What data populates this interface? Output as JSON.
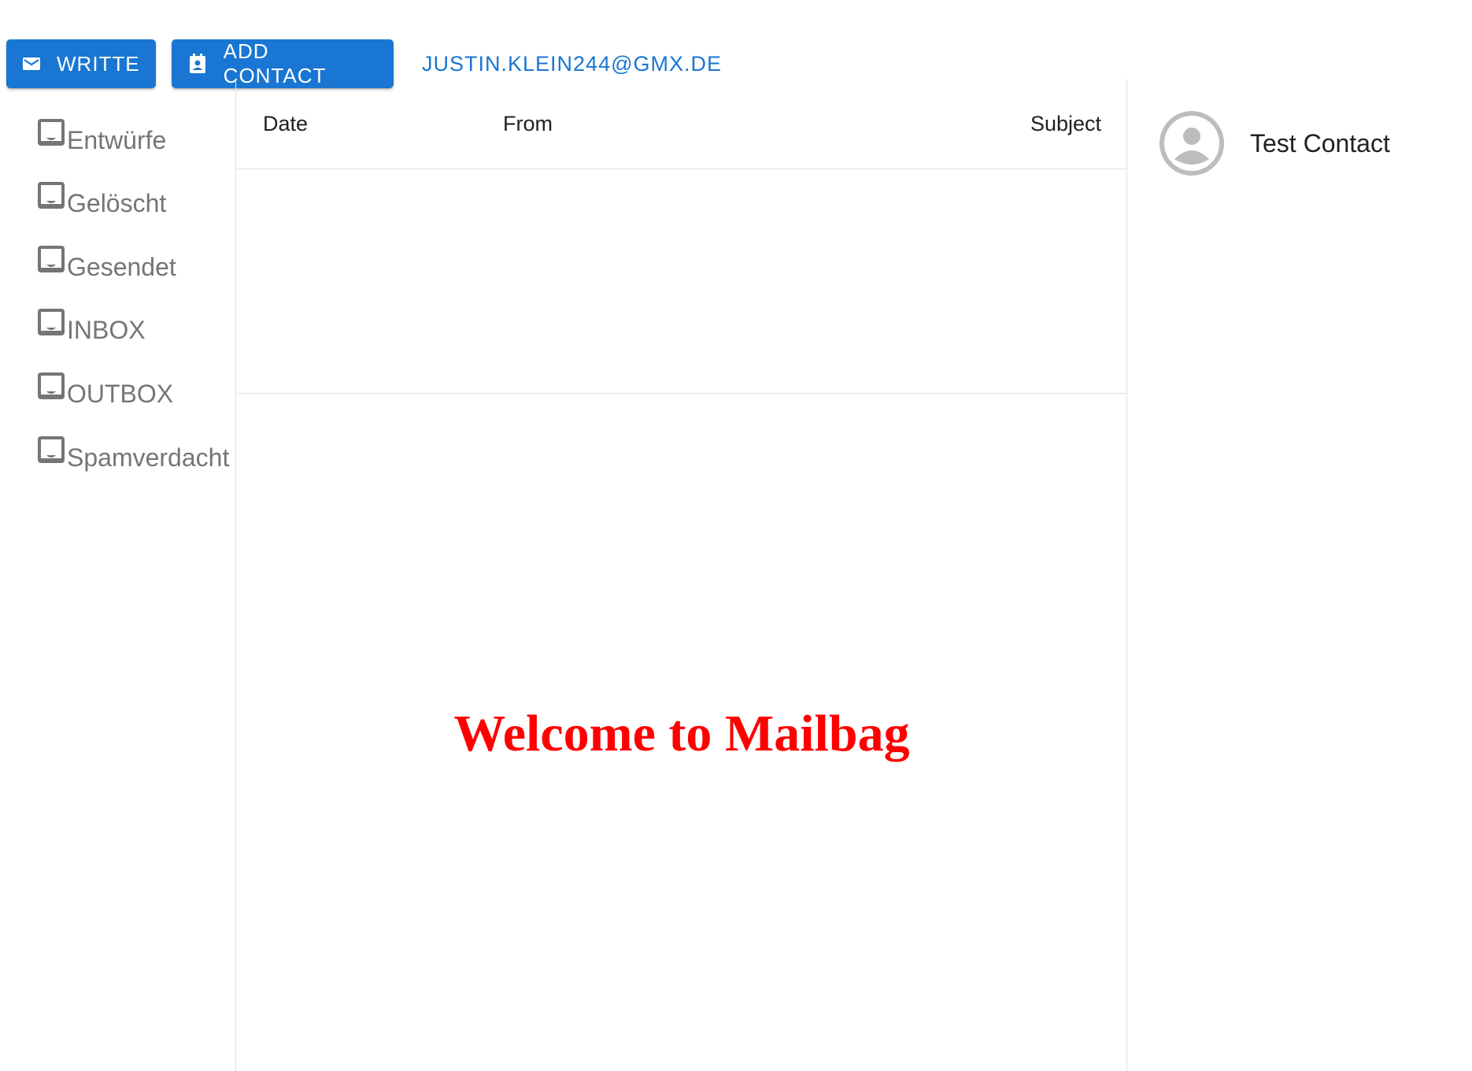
{
  "toolbar": {
    "write_label": "Writte",
    "add_contact_label": "Add Contact",
    "user_email": "justin.klein244@gmx.de"
  },
  "mailboxes": [
    {
      "label": "Entwürfe"
    },
    {
      "label": "Gelöscht"
    },
    {
      "label": "Gesendet"
    },
    {
      "label": "INBOX"
    },
    {
      "label": "OUTBOX"
    },
    {
      "label": "Spamverdacht"
    }
  ],
  "message_list": {
    "columns": {
      "date": "Date",
      "from": "From",
      "subject": "Subject"
    },
    "rows": []
  },
  "view": {
    "welcome_text": "Welcome to Mailbag"
  },
  "contacts": [
    {
      "name": "Test Contact",
      "icon": "account-circle-icon"
    }
  ],
  "colors": {
    "primary": "#1976d2",
    "welcome": "#ff0000",
    "mailbox_text": "#757575",
    "divider": "#e0e0e0"
  }
}
